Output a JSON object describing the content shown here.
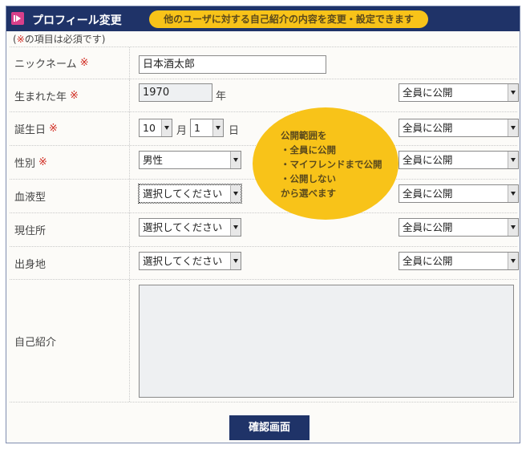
{
  "header": {
    "title": "プロフィール変更",
    "notice": "他のユーザに対する自己紹介の内容を変更・設定できます"
  },
  "required_note": {
    "open": "(",
    "mark": "※",
    "text": "の項目は必須です)"
  },
  "required_mark": "※",
  "fields": {
    "nickname": {
      "label": "ニックネーム",
      "value": "日本酒太郎"
    },
    "birth_year": {
      "label": "生まれた年",
      "value": "1970",
      "unit": "年",
      "visibility": "全員に公開"
    },
    "birthday": {
      "label": "誕生日",
      "month": "10",
      "month_unit": "月",
      "day": "1",
      "day_unit": "日",
      "visibility": "全員に公開"
    },
    "gender": {
      "label": "性別",
      "value": "男性",
      "visibility": "全員に公開"
    },
    "blood_type": {
      "label": "血液型",
      "value": "選択してください",
      "visibility": "全員に公開"
    },
    "residence": {
      "label": "現住所",
      "value": "選択してください",
      "visibility": "全員に公開"
    },
    "hometown": {
      "label": "出身地",
      "value": "選択してください",
      "visibility": "全員に公開"
    },
    "self_intro": {
      "label": "自己紹介",
      "value": ""
    }
  },
  "tooltip": {
    "line1": "公開範囲を",
    "line2": "・全員に公開",
    "line3": "・マイフレンドまで公開",
    "line4": "・公開しない",
    "line5": "から選べます"
  },
  "submit_label": "確認画面",
  "colors": {
    "header_bg": "#1f3368",
    "accent_yellow": "#f8c319",
    "required_red": "#d0291f",
    "icon_pink": "#d8408a"
  }
}
